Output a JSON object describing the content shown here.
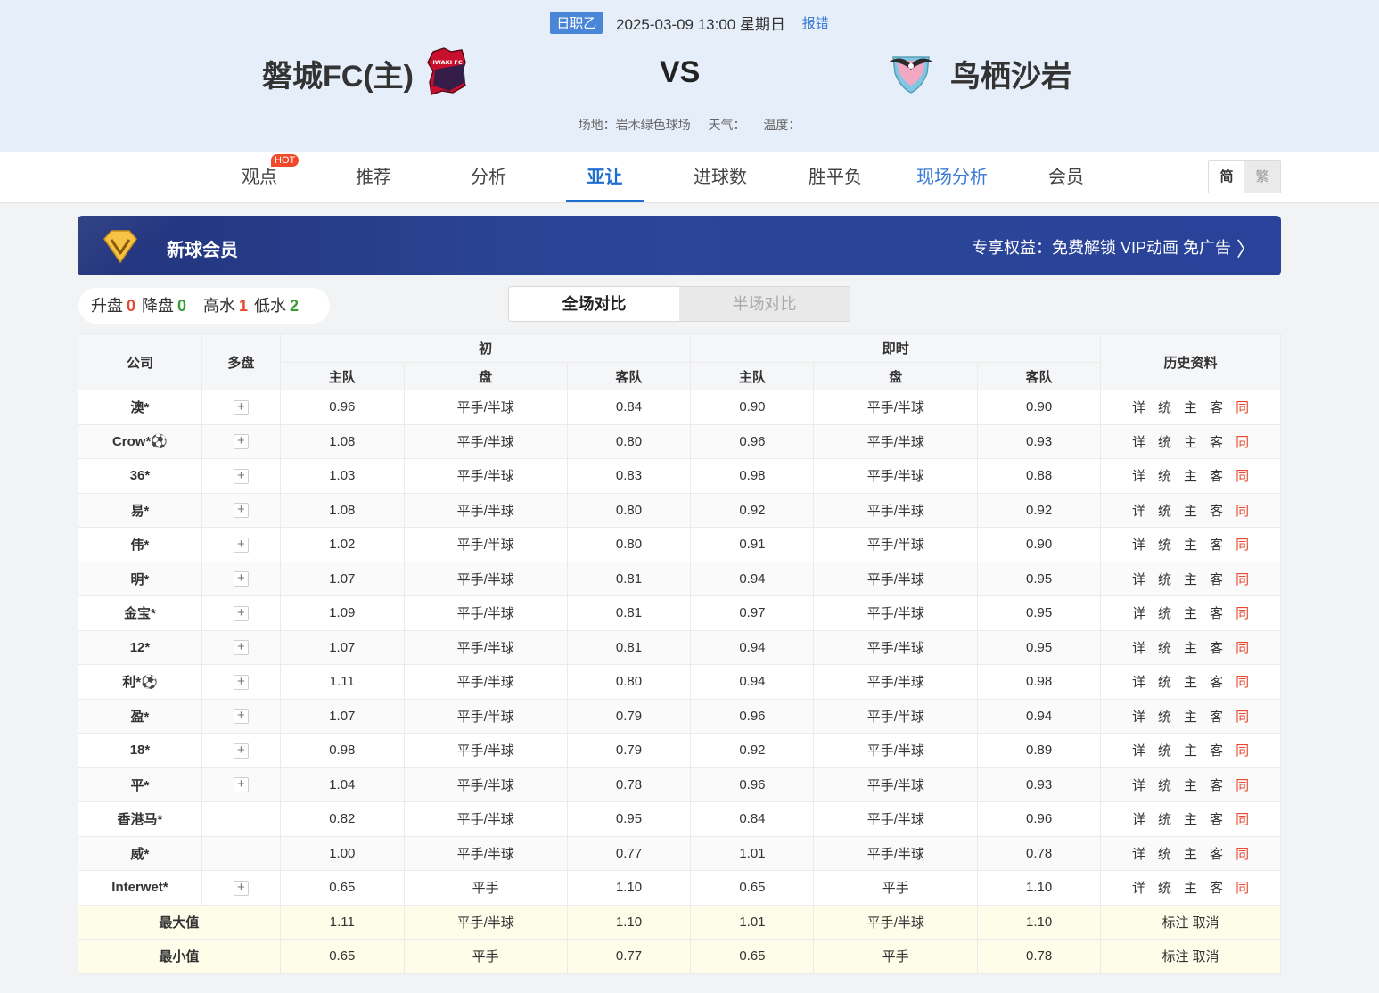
{
  "header": {
    "league": "日职乙",
    "datetime": "2025-03-09 13:00 星期日",
    "report": "报错",
    "home_team": "磐城FC(主)",
    "away_team": "鸟栖沙岩",
    "vs": "VS",
    "venue": "场地：岩木绿色球场",
    "weather": "天气：",
    "temperature": "温度：",
    "home_logo_text": "IWAKI FC"
  },
  "tabs": [
    {
      "label": "观点"
    },
    {
      "label": "推荐"
    },
    {
      "label": "分析"
    },
    {
      "label": "亚让"
    },
    {
      "label": "进球数"
    },
    {
      "label": "胜平负"
    },
    {
      "label": "现场分析"
    },
    {
      "label": "会员"
    }
  ],
  "hot_badge": "HOT",
  "lang": {
    "simple": "简",
    "traditional": "繁"
  },
  "vip": {
    "title": "新球会员",
    "benefit": "专享权益：免费解锁 VIP动画 免广告",
    "arrow": "〉"
  },
  "stats": {
    "up_label": "升盘",
    "up_value": "0",
    "down_label": "降盘",
    "down_value": "0",
    "high_label": "高水",
    "high_value": "1",
    "low_label": "低水",
    "low_value": "2"
  },
  "segment": {
    "full": "全场对比",
    "half": "半场对比"
  },
  "table": {
    "headers": {
      "company": "公司",
      "multi": "多盘",
      "initial": "初",
      "live": "即时",
      "history": "历史资料",
      "home": "主队",
      "line": "盘",
      "away": "客队"
    },
    "rows": [
      {
        "company": "澳*",
        "plus": true,
        "ih": "0.96",
        "il": "平手/半球",
        "ia": "0.84",
        "lh": "0.90",
        "ll": "平手/半球",
        "la": "0.90"
      },
      {
        "company": "Crow*⚽",
        "plus": true,
        "ih": "1.08",
        "il": "平手/半球",
        "ia": "0.80",
        "lh": "0.96",
        "ll": "平手/半球",
        "la": "0.93"
      },
      {
        "company": "36*",
        "plus": true,
        "ih": "1.03",
        "il": "平手/半球",
        "ia": "0.83",
        "lh": "0.98",
        "ll": "平手/半球",
        "la": "0.88"
      },
      {
        "company": "易*",
        "plus": true,
        "ih": "1.08",
        "il": "平手/半球",
        "ia": "0.80",
        "lh": "0.92",
        "ll": "平手/半球",
        "la": "0.92"
      },
      {
        "company": "伟*",
        "plus": true,
        "ih": "1.02",
        "il": "平手/半球",
        "ia": "0.80",
        "lh": "0.91",
        "ll": "平手/半球",
        "la": "0.90"
      },
      {
        "company": "明*",
        "plus": true,
        "ih": "1.07",
        "il": "平手/半球",
        "ia": "0.81",
        "lh": "0.94",
        "ll": "平手/半球",
        "la": "0.95"
      },
      {
        "company": "金宝*",
        "plus": true,
        "ih": "1.09",
        "il": "平手/半球",
        "ia": "0.81",
        "lh": "0.97",
        "ll": "平手/半球",
        "la": "0.95"
      },
      {
        "company": "12*",
        "plus": true,
        "ih": "1.07",
        "il": "平手/半球",
        "ia": "0.81",
        "lh": "0.94",
        "ll": "平手/半球",
        "la": "0.95"
      },
      {
        "company": "利*⚽",
        "plus": true,
        "ih": "1.11",
        "il": "平手/半球",
        "ia": "0.80",
        "lh": "0.94",
        "ll": "平手/半球",
        "la": "0.98"
      },
      {
        "company": "盈*",
        "plus": true,
        "ih": "1.07",
        "il": "平手/半球",
        "ia": "0.79",
        "lh": "0.96",
        "ll": "平手/半球",
        "la": "0.94"
      },
      {
        "company": "18*",
        "plus": true,
        "ih": "0.98",
        "il": "平手/半球",
        "ia": "0.79",
        "lh": "0.92",
        "ll": "平手/半球",
        "la": "0.89"
      },
      {
        "company": "平*",
        "plus": true,
        "ih": "1.04",
        "il": "平手/半球",
        "ia": "0.78",
        "lh": "0.96",
        "ll": "平手/半球",
        "la": "0.93"
      },
      {
        "company": "香港马*",
        "plus": false,
        "ih": "0.82",
        "il": "平手/半球",
        "ia": "0.95",
        "lh": "0.84",
        "ll": "平手/半球",
        "la": "0.96"
      },
      {
        "company": "威*",
        "plus": false,
        "ih": "1.00",
        "il": "平手/半球",
        "ia": "0.77",
        "lh": "1.01",
        "ll": "平手/半球",
        "la": "0.78"
      },
      {
        "company": "Interwet*",
        "plus": true,
        "ih": "0.65",
        "il": "平手",
        "ia": "1.10",
        "lh": "0.65",
        "ll": "平手",
        "la": "1.10"
      }
    ],
    "history_links": [
      "详",
      "统",
      "主",
      "客",
      "同"
    ],
    "summary": [
      {
        "label": "最大值",
        "ih": "1.11",
        "il": "平手/半球",
        "ia": "1.10",
        "lh": "1.01",
        "ll": "平手/半球",
        "la": "1.10"
      },
      {
        "label": "最小值",
        "ih": "0.65",
        "il": "平手",
        "ia": "0.77",
        "lh": "0.65",
        "ll": "平手",
        "la": "0.78"
      }
    ],
    "summary_links": [
      "标注",
      "取消"
    ]
  }
}
